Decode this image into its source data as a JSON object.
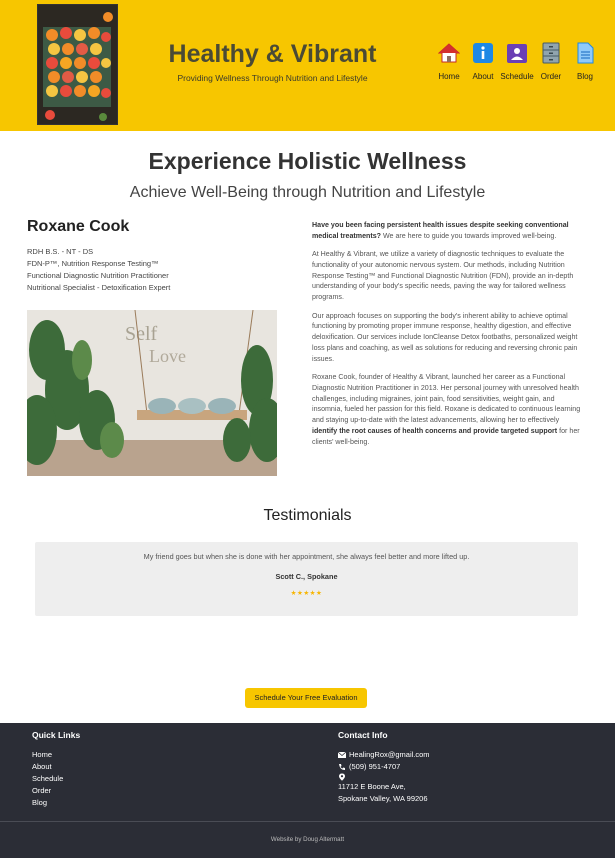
{
  "header": {
    "title": "Healthy & Vibrant",
    "subtitle": "Providing Wellness Through Nutrition and Lifestyle",
    "nav": [
      {
        "label": "Home",
        "icon": "home-icon"
      },
      {
        "label": "About",
        "icon": "info-icon"
      },
      {
        "label": "Schedule",
        "icon": "calendar-person-icon"
      },
      {
        "label": "Order",
        "icon": "cabinet-icon"
      },
      {
        "label": "Blog",
        "icon": "document-icon"
      }
    ]
  },
  "main": {
    "heading": "Experience Holistic Wellness",
    "subheading": "Achieve Well-Being through Nutrition and Lifestyle",
    "person": {
      "name": "Roxane Cook",
      "credentials": [
        "RDH B.S. - NT - DS",
        "FDN-P™, Nutrition Response Testing™",
        "Functional Diagnostic Nutrition Practitioner",
        "Nutritional Specialist - Detoxification Expert"
      ],
      "photo_text": "Self Love"
    },
    "intro_bold": "Have you been facing persistent health issues despite seeking conventional medical treatments?",
    "intro_rest": " We are here to guide you towards improved well-being.",
    "para2": "At Healthy & Vibrant, we utilize a variety of diagnostic techniques to evaluate the functionality of your autonomic nervous system. Our methods, including Nutrition Response Testing™ and Functional Diagnostic Nutrition (FDN), provide an in-depth understanding of your body's specific needs, paving the way for tailored wellness programs.",
    "para3": "Our approach focuses on supporting the body's inherent ability to achieve optimal functioning by promoting proper immune response, healthy digestion, and effective deloxification. Our services include IonCleanse Detox footbaths, personalized weight loss plans and coaching, as well as solutions for reducing and reversing chronic pain issues.",
    "para4_start": "Roxane Cook, founder of Healthy & Vibrant, launched her career as a Functional Diagnostic Nutrition Practitioner in 2013. Her personal journey with unresolved health challenges, including migraines, joint pain, food sensitivities, weight gain, and insomnia, fueled her passion for this field. Roxane is dedicated to continuous learning and staying up-to-date with the latest advancements, allowing her to effectively ",
    "para4_bold": "identify the root causes of health concerns and provide targeted support",
    "para4_end": " for her clients' well-being."
  },
  "testimonials": {
    "title": "Testimonials",
    "quote": "My friend goes but when she is done with her appointment, she always feel better and more lifted up.",
    "author": "Scott C., Spokane",
    "stars": "★★★★★",
    "rating": 5
  },
  "cta": {
    "label": "Schedule Your Free Evaluation"
  },
  "footer": {
    "quick_links_title": "Quick Links",
    "links": [
      "Home",
      "About",
      "Schedule",
      "Order",
      "Blog"
    ],
    "contact_title": "Contact Info",
    "email": "HealingRox@gmail.com",
    "phone": "(509) 951-4707",
    "address_line1": "11712 E Boone Ave,",
    "address_line2": "Spokane Valley, WA 99206",
    "credit": "Website by Doug Altermatt"
  },
  "colors": {
    "accent": "#f7c600",
    "footer_bg": "#2b2d36",
    "testimonial_bg": "#eeeeee"
  }
}
